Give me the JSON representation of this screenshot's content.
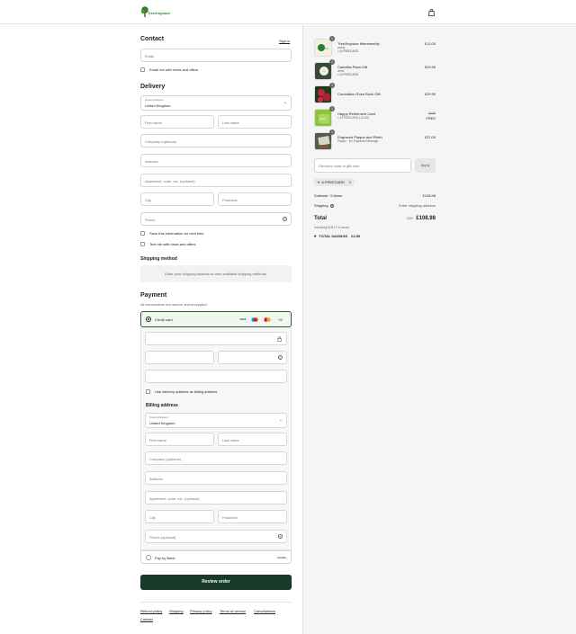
{
  "header": {
    "logo_text": "Tree2mydoor",
    "logo_icon": "tree-logo-icon",
    "cart_icon": "shopping-bag-icon"
  },
  "contact": {
    "title": "Contact",
    "sign_in": "Sign in",
    "email_placeholder": "Email",
    "email_offers": "Email me with news and offers"
  },
  "delivery": {
    "title": "Delivery",
    "country_label": "Country/Region",
    "country_value": "United Kingdom",
    "first_name": "First name",
    "last_name": "Last name",
    "company": "Company (optional)",
    "address": "Address",
    "apartment": "Apartment, suite, etc. (optional)",
    "city": "City",
    "postcode": "Postcode",
    "phone": "Phone",
    "save_info": "Save this information for next time",
    "text_offers": "Text me with news and offers"
  },
  "shipping": {
    "title": "Shipping method",
    "note": "Enter your shipping address to view available shipping methods."
  },
  "payment": {
    "title": "Payment",
    "subtitle": "All transactions are secure and encrypted.",
    "credit_card": "Credit card",
    "card_brands": [
      "VISA",
      "Maestro",
      "Mastercard"
    ],
    "more_brands": "+5",
    "use_delivery": "Use delivery address as billing address",
    "billing_title": "Billing address",
    "billing_country_label": "Country/Region",
    "billing_country_value": "United Kingdom",
    "billing_first": "First name",
    "billing_last": "Last name",
    "billing_company": "Company (optional)",
    "billing_address": "Address",
    "billing_apartment": "Apartment, suite, etc. (optional)",
    "billing_city": "City",
    "billing_postcode": "Postcode",
    "billing_phone": "Phone (optional)",
    "pay_by_bank": "Pay by Bank",
    "pay_by_bank_logo": "monzo"
  },
  "review_button": "Review order",
  "footer_links": [
    "Refund policy",
    "Shipping",
    "Privacy policy",
    "Terms of service",
    "Cancellations",
    "Contact"
  ],
  "order": {
    "items": [
      {
        "qty": "1",
        "name": "Tree2mydoor Membership",
        "variant": "yearly",
        "discount": "A.FREECARD",
        "price": "£12.00",
        "thumb_color": "#f4f0e0"
      },
      {
        "qty": "1",
        "name": "Camellia Plant Gift",
        "variant": "white",
        "discount": "A.FREECARD",
        "price": "£29.99",
        "thumb_color": "#dde2d8"
      },
      {
        "qty": "1",
        "name": "Coronation Rose Bush Gift",
        "variant": "",
        "discount": "",
        "price": "£29.99",
        "thumb_color": "#b2243a"
      },
      {
        "qty": "1",
        "name": "Happy Retirement Card",
        "variant": "",
        "discount": "A.FREECARD (-£2.50)",
        "orig_price": "£2.50",
        "price": "FREE",
        "thumb_color": "#8cc63f"
      },
      {
        "qty": "1",
        "name": "Engraved Plaque and Plinth",
        "variant": "Plaque - No Engraved Message",
        "discount": "",
        "price": "£37.00",
        "thumb_color": "#6b6f62"
      }
    ],
    "discount_placeholder": "Discount code or gift card",
    "apply": "Apply",
    "applied_code": "A.FREECARD",
    "subtotal_label": "Subtotal · 5 items",
    "subtotal_value": "£108.98",
    "shipping_label": "Shipping",
    "shipping_value": "Enter shipping address",
    "total_label": "Total",
    "currency": "GBP",
    "total_value": "£108.98",
    "taxes": "Including £18.17 in taxes",
    "savings_label": "TOTAL SAVINGS",
    "savings_value": "£2.50"
  }
}
